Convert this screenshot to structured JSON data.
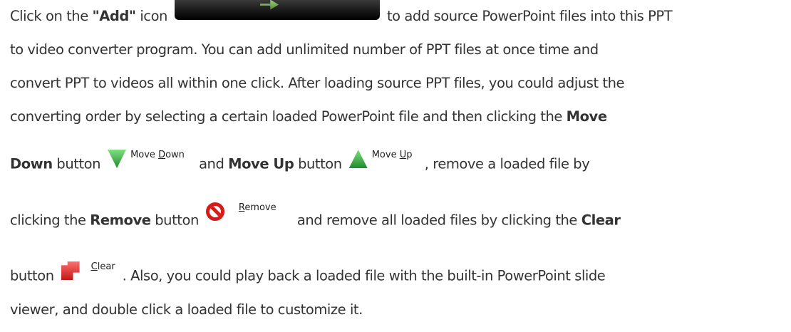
{
  "lines": {
    "l1": {
      "a": "Click on the ",
      "b": "\"Add\"",
      "c": " icon",
      "d": "to add source PowerPoint files into this PPT"
    },
    "l2": {
      "a": "to video converter program. You can add unlimited number of PPT files at once time and"
    },
    "l3": {
      "a": "convert PPT to videos all within one click. After loading source PPT files, you could adjust the"
    },
    "l4": {
      "a": "converting order by selecting a certain loaded PowerPoint file and then clicking the ",
      "b": "Move"
    },
    "l5": {
      "a": "Down",
      "b": " button",
      "c": "and ",
      "d": "Move Up",
      "e": " button",
      "f": ", remove a loaded file by"
    },
    "l6": {
      "a": "clicking the ",
      "b": "Remove",
      "c": " button",
      "d": "and remove all loaded files by clicking the ",
      "e": "Clear"
    },
    "l7": {
      "a": "button",
      "b": ". Also, you could play back a loaded file with the built-in PowerPoint slide"
    },
    "l8": {
      "a": "viewer, and double click a loaded file to customize it."
    }
  },
  "buttons": {
    "move_down": {
      "pre": "Move ",
      "key": "D",
      "post": "own",
      "icon": "move-down-arrow-icon"
    },
    "move_up": {
      "pre": "Move ",
      "key": "U",
      "post": "p",
      "icon": "move-up-arrow-icon"
    },
    "remove": {
      "key": "R",
      "post": "emove",
      "icon": "no-entry-icon"
    },
    "clear": {
      "key": "C",
      "post": "lear",
      "icon": "clear-icon"
    }
  },
  "colors": {
    "text": "#333333",
    "add_button_bg": "#151515",
    "arrow_green": "#1e8c2e",
    "remove_red": "#d71a1a"
  }
}
